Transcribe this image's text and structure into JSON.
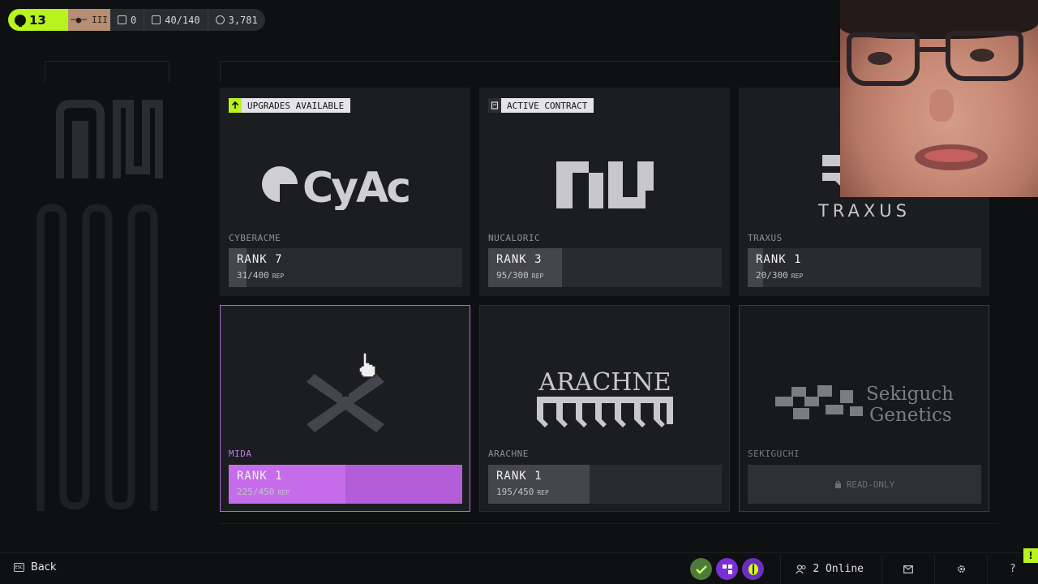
{
  "hud": {
    "level": "13",
    "stat1": "0",
    "stat2": "40/140",
    "stat3": "3,781"
  },
  "factions": [
    {
      "name": "CYBERACME",
      "logo_text": "CyAc",
      "rank": "RANK 7",
      "rep": "31/400",
      "rep_unit": "REP",
      "progress": 0.0775,
      "badge": "UPGRADES AVAILABLE"
    },
    {
      "name": "NUCALORIC",
      "rank": "RANK 3",
      "rep": "95/300",
      "rep_unit": "REP",
      "progress": 0.3167,
      "badge": "ACTIVE CONTRACT"
    },
    {
      "name": "TRAXUS",
      "logo_text": "TRAXUS",
      "rank": "RANK 1",
      "rep": "20/300",
      "rep_unit": "REP",
      "progress": 0.0667
    },
    {
      "name": "MIDA",
      "rank": "RANK 1",
      "rep": "225/450",
      "rep_unit": "REP",
      "progress": 0.5
    },
    {
      "name": "ARACHNE",
      "logo_text": "ARACHNE",
      "rank": "RANK 1",
      "rep": "195/450",
      "rep_unit": "REP",
      "progress": 0.4333
    },
    {
      "name": "SEKIGUCHI",
      "logo_line1": "Sekiguchi",
      "logo_line2": "Genetics",
      "status": "READ-ONLY"
    }
  ],
  "bottom": {
    "back_label": "Back",
    "online": "2 Online",
    "alert": "!"
  },
  "colors": {
    "accent_green": "#b7f31d",
    "mida_purple": "#c66ceb",
    "card_bg": "#1c1d20"
  }
}
